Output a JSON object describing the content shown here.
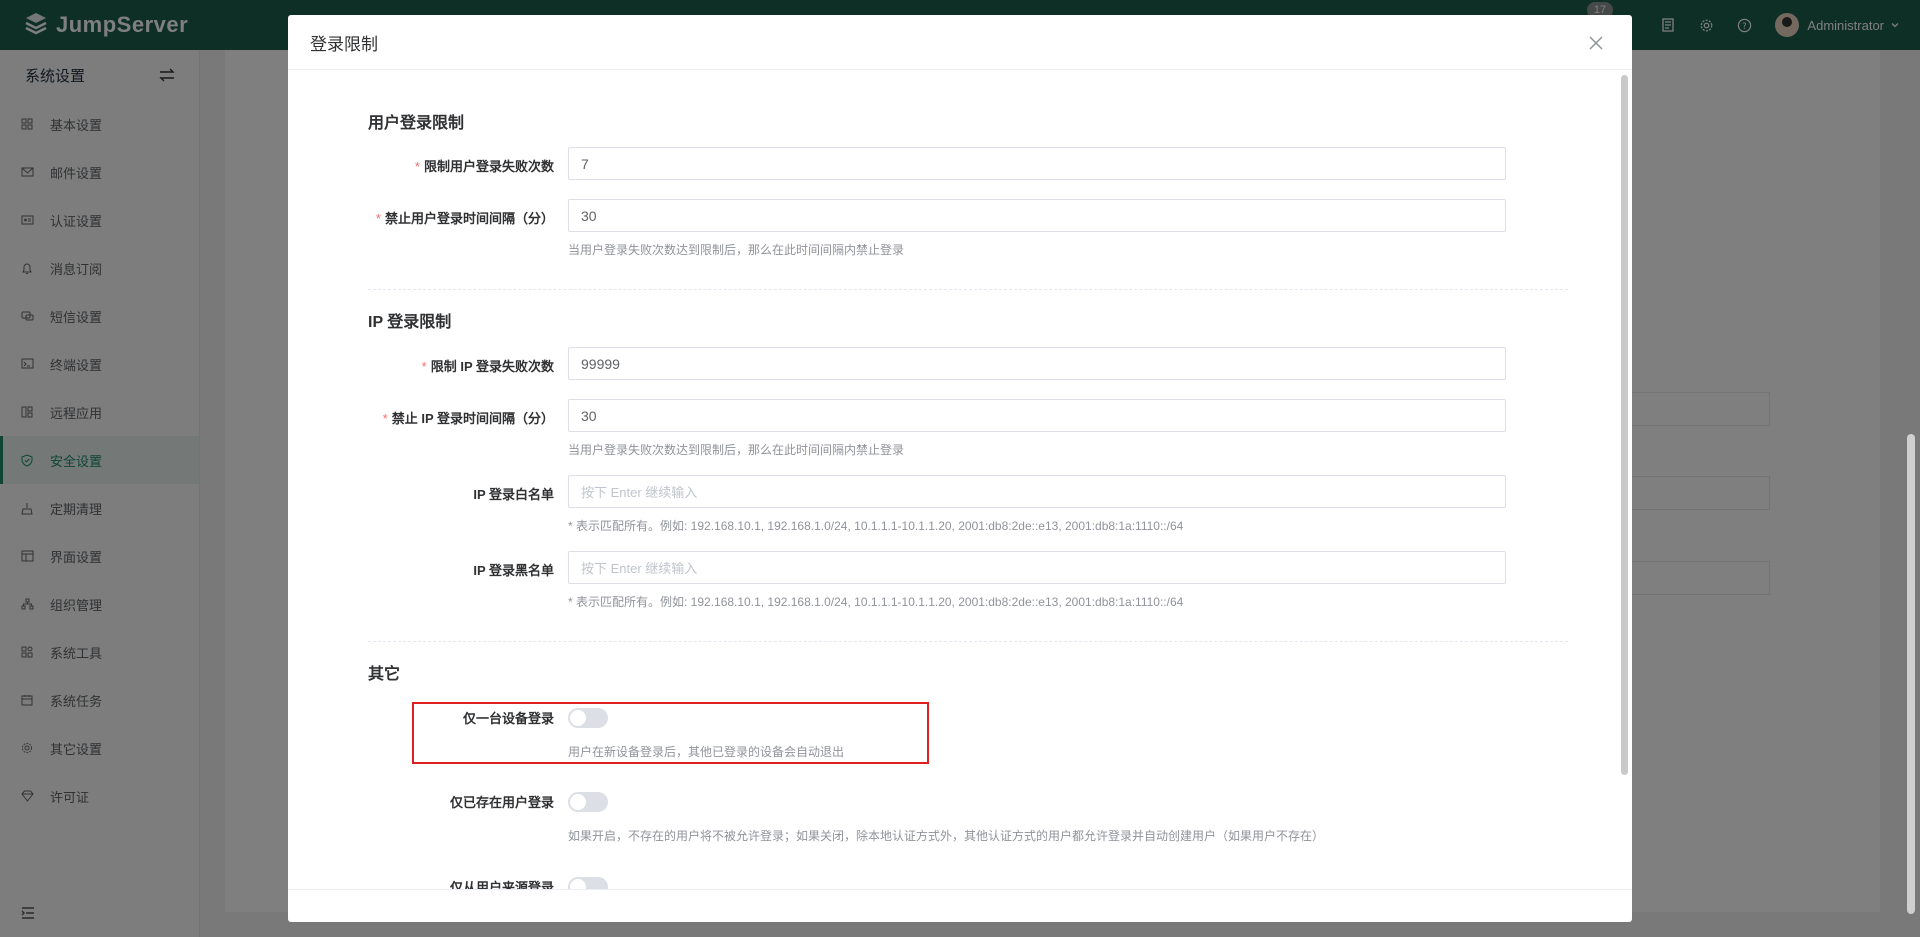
{
  "header": {
    "brand": "JumpServer",
    "notification_count": "17",
    "user_name": "Administrator"
  },
  "sidebar": {
    "title": "系统设置",
    "items": [
      {
        "label": "基本设置",
        "icon": "grid-icon"
      },
      {
        "label": "邮件设置",
        "icon": "mail-icon"
      },
      {
        "label": "认证设置",
        "icon": "id-card-icon"
      },
      {
        "label": "消息订阅",
        "icon": "bell-icon"
      },
      {
        "label": "短信设置",
        "icon": "message-icon"
      },
      {
        "label": "终端设置",
        "icon": "terminal-icon"
      },
      {
        "label": "远程应用",
        "icon": "app-icon"
      },
      {
        "label": "安全设置",
        "icon": "shield-icon"
      },
      {
        "label": "定期清理",
        "icon": "broom-icon"
      },
      {
        "label": "界面设置",
        "icon": "layout-icon"
      },
      {
        "label": "组织管理",
        "icon": "org-icon"
      },
      {
        "label": "系统工具",
        "icon": "tools-icon"
      },
      {
        "label": "系统任务",
        "icon": "calendar-icon"
      },
      {
        "label": "其它设置",
        "icon": "gear-icon"
      },
      {
        "label": "许可证",
        "icon": "diamond-icon"
      }
    ],
    "active_index": 7
  },
  "dialog": {
    "title": "登录限制",
    "sections": {
      "user": {
        "title": "用户登录限制",
        "fail_limit_label": "限制用户登录失败次数",
        "fail_limit_value": "7",
        "block_interval_label": "禁止用户登录时间间隔（分）",
        "block_interval_value": "30",
        "block_interval_help": "当用户登录失败次数达到限制后，那么在此时间间隔内禁止登录"
      },
      "ip": {
        "title": "IP 登录限制",
        "fail_limit_label": "限制 IP 登录失败次数",
        "fail_limit_value": "99999",
        "block_interval_label": "禁止 IP 登录时间间隔（分）",
        "block_interval_value": "30",
        "block_interval_help": "当用户登录失败次数达到限制后，那么在此时间间隔内禁止登录",
        "whitelist_label": "IP 登录白名单",
        "whitelist_placeholder": "按下 Enter 继续输入",
        "whitelist_help": "* 表示匹配所有。例如: 192.168.10.1, 192.168.1.0/24, 10.1.1.1-10.1.1.20, 2001:db8:2de::e13, 2001:db8:1a:1110::/64",
        "blacklist_label": "IP 登录黑名单",
        "blacklist_placeholder": "按下 Enter 继续输入",
        "blacklist_help": "* 表示匹配所有。例如: 192.168.10.1, 192.168.1.0/24, 10.1.1.1-10.1.1.20, 2001:db8:2de::e13, 2001:db8:1a:1110::/64"
      },
      "other": {
        "title": "其它",
        "single_device_label": "仅一台设备登录",
        "single_device_on": false,
        "single_device_help": "用户在新设备登录后，其他已登录的设备会自动退出",
        "existing_user_label": "仅已存在用户登录",
        "existing_user_on": false,
        "existing_user_help": "如果开启，不存在的用户将不被允许登录；如果关闭，除本地认证方式外，其他认证方式的用户都允许登录并自动创建用户（如果用户不存在）",
        "source_login_label": "仅从用户来源登录",
        "source_login_on": false
      }
    }
  },
  "colors": {
    "header_bg": "#1d5f4d",
    "accent": "#1d8a6a",
    "highlight_box": "#e02020",
    "required": "#f56c6c"
  }
}
